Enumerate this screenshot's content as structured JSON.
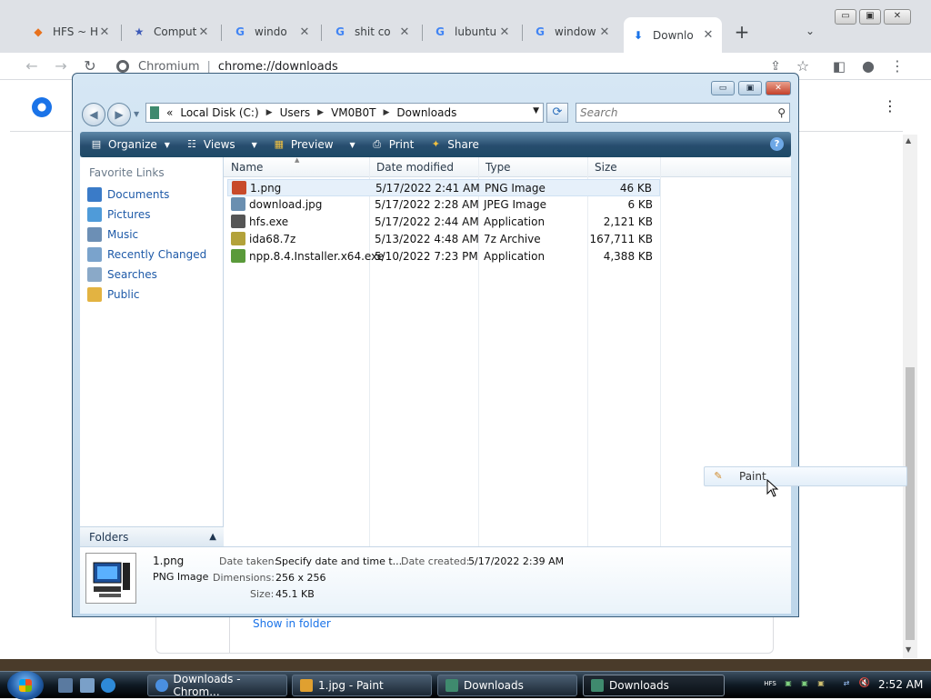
{
  "chrome": {
    "tabs": [
      {
        "title": "HFS ~ H",
        "icon": "hfs-icon"
      },
      {
        "title": "Comput",
        "icon": "star-icon"
      },
      {
        "title": "windo",
        "icon": "google-icon"
      },
      {
        "title": "shit co",
        "icon": "google-icon"
      },
      {
        "title": "lubuntu",
        "icon": "google-icon"
      },
      {
        "title": "window",
        "icon": "google-icon"
      },
      {
        "title": "Downlo",
        "icon": "download-icon",
        "active": true
      }
    ],
    "site_label": "Chromium",
    "url": "chrome://downloads"
  },
  "downloads_page": {
    "show_in_folder": "Show in folder"
  },
  "explorer": {
    "breadcrumb": [
      "Local Disk (C:)",
      "Users",
      "VM0B0T",
      "Downloads"
    ],
    "search_placeholder": "Search",
    "commands": {
      "organize": "Organize",
      "views": "Views",
      "preview": "Preview",
      "print": "Print",
      "share": "Share"
    },
    "favorite_links_header": "Favorite Links",
    "favorite_links": [
      {
        "label": "Documents",
        "color": "#3a7bc8"
      },
      {
        "label": "Pictures",
        "color": "#4f9bd9"
      },
      {
        "label": "Music",
        "color": "#6c8fb5"
      },
      {
        "label": "Recently Changed",
        "color": "#7aa3cc"
      },
      {
        "label": "Searches",
        "color": "#8aa9c8"
      },
      {
        "label": "Public",
        "color": "#e3b341"
      }
    ],
    "folders_label": "Folders",
    "columns": [
      "Name",
      "Date modified",
      "Type",
      "Size"
    ],
    "files": [
      {
        "name": "1.png",
        "date": "5/17/2022 2:41 AM",
        "type": "PNG Image",
        "size": "46 KB",
        "selected": true,
        "color": "#c84a2a"
      },
      {
        "name": "download.jpg",
        "date": "5/17/2022 2:28 AM",
        "type": "JPEG Image",
        "size": "6 KB",
        "color": "#6a8fb0"
      },
      {
        "name": "hfs.exe",
        "date": "5/17/2022 2:44 AM",
        "type": "Application",
        "size": "2,121 KB",
        "color": "#555555"
      },
      {
        "name": "ida68.7z",
        "date": "5/13/2022 4:48 AM",
        "type": "7z Archive",
        "size": "167,711 KB",
        "color": "#b3a23a"
      },
      {
        "name": "npp.8.4.Installer.x64.exe",
        "date": "5/10/2022 7:23 PM",
        "type": "Application",
        "size": "4,388 KB",
        "color": "#5a9a3a"
      }
    ],
    "drag_popup": "Paint",
    "details": {
      "filename": "1.png",
      "filetype": "PNG Image",
      "date_taken_label": "Date taken:",
      "date_taken_value": "Specify date and time t...",
      "date_created_label": "Date created:",
      "date_created_value": "5/17/2022 2:39 AM",
      "dimensions_label": "Dimensions:",
      "dimensions_value": "256 x 256",
      "size_label": "Size:",
      "size_value": "45.1 KB"
    }
  },
  "taskbar": {
    "tasks": [
      {
        "label": "Downloads - Chrom...",
        "icon": "chromium-icon",
        "color": "#4a8fe0"
      },
      {
        "label": "1.jpg - Paint",
        "icon": "paint-icon",
        "color": "#e0a030"
      },
      {
        "label": "Downloads",
        "icon": "folder-icon",
        "color": "#3f8a6e"
      },
      {
        "label": "Downloads",
        "icon": "folder-icon",
        "color": "#3f8a6e",
        "active": true
      }
    ],
    "tray_hfs": "HFS",
    "clock": "2:52 AM"
  }
}
